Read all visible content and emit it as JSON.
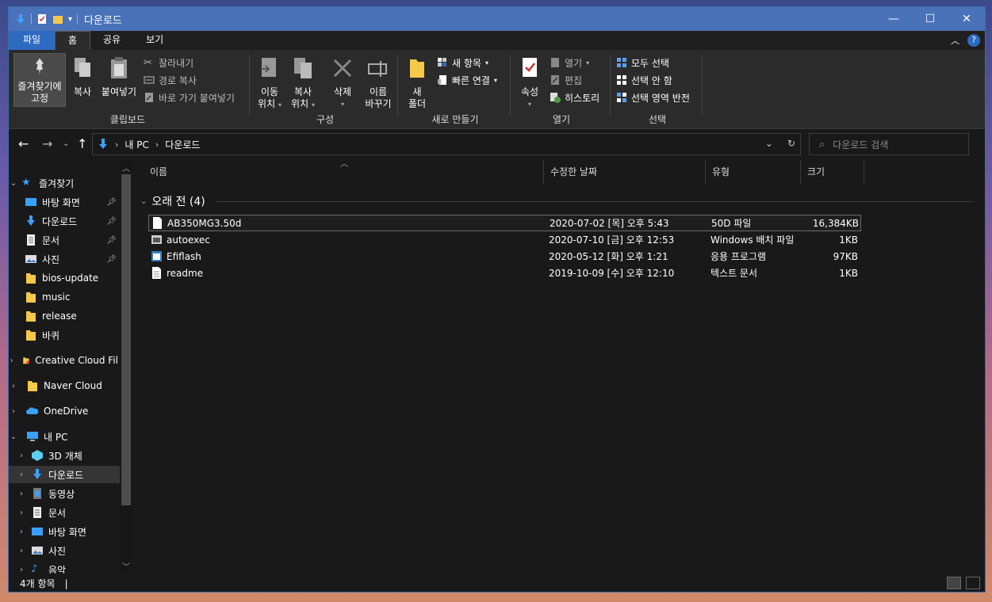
{
  "window": {
    "title": "다운로드"
  },
  "menu": {
    "file": "파일",
    "home": "홈",
    "share": "공유",
    "view": "보기"
  },
  "ribbon": {
    "clipboard": {
      "pin_line1": "즐겨찾기에",
      "pin_line2": "고정",
      "copy": "복사",
      "paste": "붙여넣기",
      "cut": "잘라내기",
      "copy_path": "경로 복사",
      "paste_shortcut": "바로 가기 붙여넣기",
      "label": "클립보드"
    },
    "organize": {
      "move_line1": "이동",
      "move_line2": "위치",
      "copy_line1": "복사",
      "copy_line2": "위치",
      "delete": "삭제",
      "rename_line1": "이름",
      "rename_line2": "바꾸기",
      "label": "구성"
    },
    "new": {
      "folder_line1": "새",
      "folder_line2": "폴더",
      "new_item": "새 항목",
      "easy_access": "빠른 연결",
      "label": "새로 만들기"
    },
    "open": {
      "properties": "속성",
      "open": "열기",
      "edit": "편집",
      "history": "히스토리",
      "label": "열기"
    },
    "select": {
      "select_all": "모두 선택",
      "select_none": "선택 안 함",
      "invert": "선택 영역 반전",
      "label": "선택"
    }
  },
  "address": {
    "crumb_pc": "내 PC",
    "crumb_folder": "다운로드",
    "search_placeholder": "다운로드 검색"
  },
  "sidebar": {
    "quick_access": "즐겨찾기",
    "desktop": "바탕 화면",
    "downloads": "다운로드",
    "documents": "문서",
    "pictures": "사진",
    "bios": "bios-update",
    "music": "music",
    "release": "release",
    "wallpaper": "바퀴",
    "creative_cloud": "Creative Cloud Fil",
    "naver_cloud": "Naver Cloud",
    "onedrive": "OneDrive",
    "this_pc": "내 PC",
    "objects3d": "3D 개체",
    "pc_downloads": "다운로드",
    "videos": "동영상",
    "pc_documents": "문서",
    "pc_desktop": "바탕 화면",
    "pc_pictures": "사진",
    "pc_music": "음악"
  },
  "columns": {
    "name": "이름",
    "modified": "수정한 날짜",
    "type": "유형",
    "size": "크기"
  },
  "group": {
    "title": "오래 전 (4)"
  },
  "files": [
    {
      "name": "AB350MG3.50d",
      "modified": "2020-07-02 [목] 오후 5:43",
      "type": "50D 파일",
      "size": "16,384KB"
    },
    {
      "name": "autoexec",
      "modified": "2020-07-10 [금] 오후 12:53",
      "type": "Windows 배치 파일",
      "size": "1KB"
    },
    {
      "name": "Efiflash",
      "modified": "2020-05-12 [화] 오후 1:21",
      "type": "응용 프로그램",
      "size": "97KB"
    },
    {
      "name": "readme",
      "modified": "2019-10-09 [수] 오후 12:10",
      "type": "텍스트 문서",
      "size": "1KB"
    }
  ],
  "status": {
    "count": "4개 항목"
  },
  "colors": {
    "accent": "#2d6bc0",
    "titlebar": "#4a72b8",
    "background": "#191919",
    "ribbon": "#2b2b2b",
    "folder": "#f5c84a"
  }
}
